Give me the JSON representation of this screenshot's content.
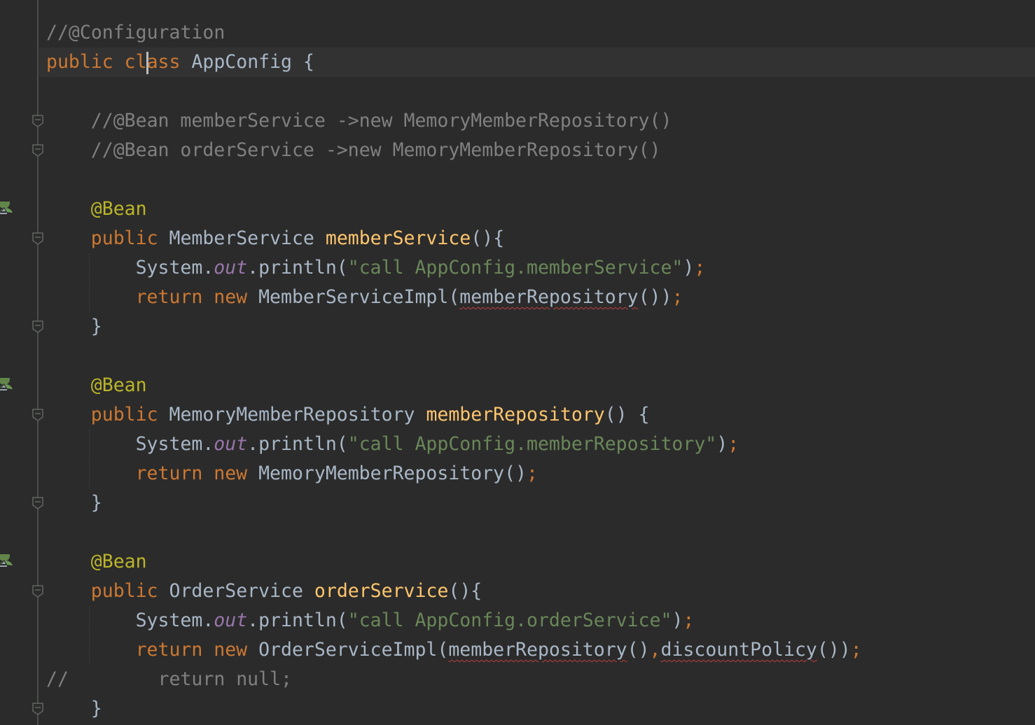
{
  "editor": {
    "lines": [
      {
        "indent": 0,
        "tokens": [
          [
            "//@Configuration",
            "cm"
          ]
        ]
      },
      {
        "indent": 0,
        "tokens": [
          [
            "public class ",
            "kw"
          ],
          [
            "AppConfig {",
            "pl"
          ]
        ]
      },
      {
        "indent": 0,
        "tokens": []
      },
      {
        "indent": 1,
        "tokens": [
          [
            "//@Bean memberService ->new MemoryMemberRepository()",
            "cm"
          ]
        ]
      },
      {
        "indent": 1,
        "tokens": [
          [
            "//@Bean orderService ->new MemoryMemberRepository()",
            "cm"
          ]
        ]
      },
      {
        "indent": 0,
        "tokens": []
      },
      {
        "indent": 1,
        "tokens": [
          [
            "@Bean",
            "an"
          ]
        ]
      },
      {
        "indent": 1,
        "tokens": [
          [
            "public ",
            "kw"
          ],
          [
            "MemberService ",
            "pl"
          ],
          [
            "memberService",
            "fn"
          ],
          [
            "(){",
            "pl"
          ]
        ]
      },
      {
        "indent": 2,
        "tokens": [
          [
            "System.",
            "pl"
          ],
          [
            "out",
            "it"
          ],
          [
            ".println(",
            "pl"
          ],
          [
            "\"call AppConfig.memberService\"",
            "str"
          ],
          [
            ")",
            "pl"
          ],
          [
            ";",
            "kw"
          ]
        ]
      },
      {
        "indent": 2,
        "tokens": [
          [
            "return new ",
            "kw"
          ],
          [
            "MemberServiceImpl(",
            "pl"
          ],
          [
            "memberRepository",
            "err"
          ],
          [
            "())",
            "pl"
          ],
          [
            ";",
            "kw"
          ]
        ]
      },
      {
        "indent": 1,
        "tokens": [
          [
            "}",
            "pl"
          ]
        ]
      },
      {
        "indent": 0,
        "tokens": []
      },
      {
        "indent": 1,
        "tokens": [
          [
            "@Bean",
            "an"
          ]
        ]
      },
      {
        "indent": 1,
        "tokens": [
          [
            "public ",
            "kw"
          ],
          [
            "MemoryMemberRepository ",
            "pl"
          ],
          [
            "memberRepository",
            "fn"
          ],
          [
            "() {",
            "pl"
          ]
        ]
      },
      {
        "indent": 2,
        "tokens": [
          [
            "System.",
            "pl"
          ],
          [
            "out",
            "it"
          ],
          [
            ".println(",
            "pl"
          ],
          [
            "\"call AppConfig.memberRepository\"",
            "str"
          ],
          [
            ")",
            "pl"
          ],
          [
            ";",
            "kw"
          ]
        ]
      },
      {
        "indent": 2,
        "tokens": [
          [
            "return new ",
            "kw"
          ],
          [
            "MemoryMemberRepository()",
            "pl"
          ],
          [
            ";",
            "kw"
          ]
        ]
      },
      {
        "indent": 1,
        "tokens": [
          [
            "}",
            "pl"
          ]
        ]
      },
      {
        "indent": 0,
        "tokens": []
      },
      {
        "indent": 1,
        "tokens": [
          [
            "@Bean",
            "an"
          ]
        ]
      },
      {
        "indent": 1,
        "tokens": [
          [
            "public ",
            "kw"
          ],
          [
            "OrderService ",
            "pl"
          ],
          [
            "orderService",
            "fn"
          ],
          [
            "(){",
            "pl"
          ]
        ]
      },
      {
        "indent": 2,
        "tokens": [
          [
            "System.",
            "pl"
          ],
          [
            "out",
            "it"
          ],
          [
            ".println(",
            "pl"
          ],
          [
            "\"call AppConfig.orderService\"",
            "str"
          ],
          [
            ")",
            "pl"
          ],
          [
            ";",
            "kw"
          ]
        ]
      },
      {
        "indent": 2,
        "tokens": [
          [
            "return new ",
            "kw"
          ],
          [
            "OrderServiceImpl(",
            "pl"
          ],
          [
            "memberRepository",
            "err"
          ],
          [
            "()",
            "pl"
          ],
          [
            ",",
            "kw"
          ],
          [
            "discountPolicy",
            "err"
          ],
          [
            "())",
            "pl"
          ],
          [
            ";",
            "kw"
          ]
        ]
      },
      {
        "indent": 0,
        "tokens": [
          [
            "//        return null;",
            "cm"
          ]
        ]
      },
      {
        "indent": 1,
        "tokens": [
          [
            "}",
            "pl"
          ]
        ]
      }
    ],
    "fold_lines": [
      3,
      4,
      7,
      10,
      13,
      16,
      19,
      23
    ],
    "bean_icon_lines": [
      6,
      12,
      18
    ],
    "current_line": 1
  },
  "colors": {
    "background": "#2b2b2b",
    "keyword": "#cc7832",
    "comment": "#808080",
    "annotation": "#bbb529",
    "method": "#ffc66d",
    "string": "#6a8759",
    "text": "#a9b7c6"
  }
}
